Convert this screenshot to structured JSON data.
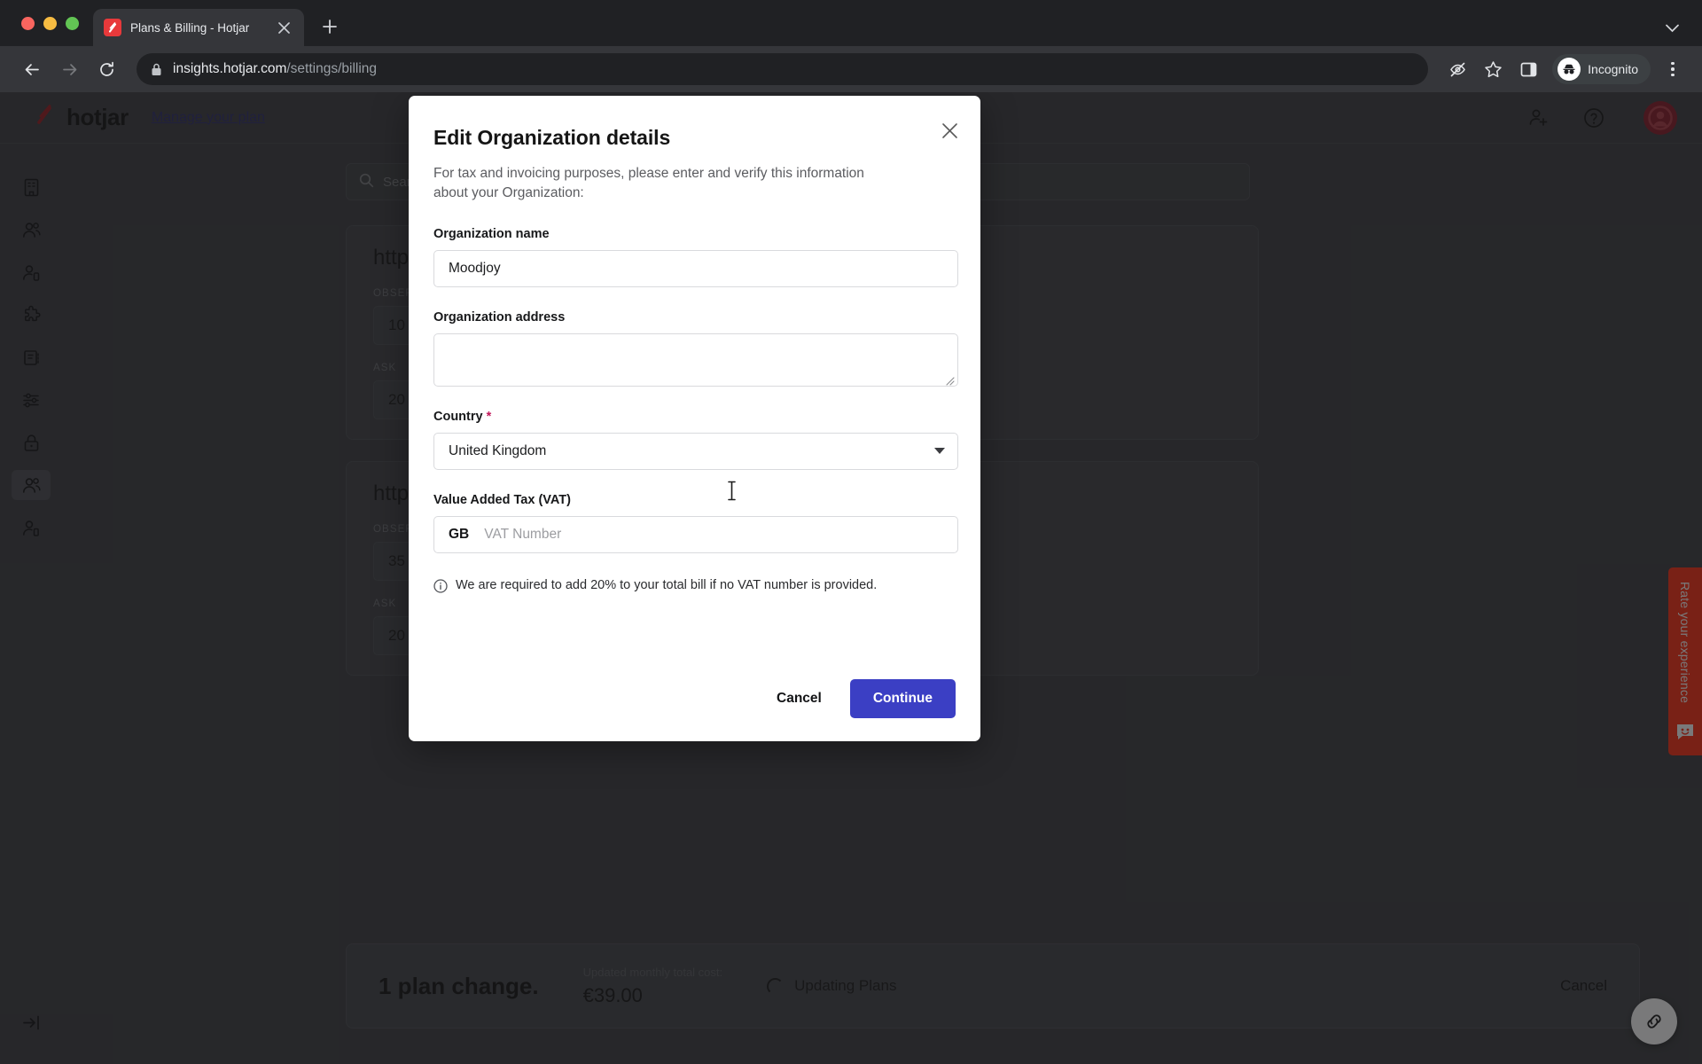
{
  "browser": {
    "tab": {
      "title": "Plans & Billing - Hotjar",
      "favicon_icon": "hotjar-favicon",
      "close_icon": "close-icon"
    },
    "new_tab_icon": "plus-icon",
    "tab_list_icon": "chevron-down-icon",
    "back_icon": "arrow-left-icon",
    "forward_icon": "arrow-right-icon",
    "reload_icon": "reload-icon",
    "url": {
      "host": "insights.hotjar.com",
      "path": "/settings/billing",
      "lock_icon": "lock-icon"
    },
    "toolbar_icons": [
      "eye-off-icon",
      "star-icon",
      "side-panel-icon"
    ],
    "incognito": {
      "label": "Incognito",
      "icon": "incognito-icon"
    },
    "menu_icon": "kebab-menu-icon"
  },
  "app": {
    "logo_text": "hotjar",
    "logo_icon": "hotjar-logo-icon",
    "manage_plan_link": "Manage your plan",
    "header_icons": [
      "add-user-icon",
      "help-circle-icon",
      "user-avatar-icon"
    ],
    "sidebar": {
      "items": [
        {
          "icon": "building-icon",
          "active": false
        },
        {
          "icon": "users-icon",
          "active": false
        },
        {
          "icon": "user-settings-icon",
          "active": false
        },
        {
          "icon": "puzzle-piece-icon",
          "active": false
        },
        {
          "icon": "notebook-icon",
          "active": false
        },
        {
          "icon": "sliders-icon",
          "active": false
        },
        {
          "icon": "lock-icon",
          "active": false
        },
        {
          "icon": "team-members-icon",
          "active": true
        },
        {
          "icon": "user-profile-icon",
          "active": false
        }
      ],
      "collapse_icon": "expand-sidebar-icon"
    },
    "search_placeholder": "Search",
    "search_icon": "search-icon",
    "plan_cards": [
      {
        "url": "http",
        "rows": [
          {
            "kicker": "OBSERVE",
            "value": "10"
          },
          {
            "kicker": "ASK",
            "value": "20"
          }
        ]
      },
      {
        "url": "http",
        "rows": [
          {
            "kicker": "OBSERVE",
            "value": "35"
          },
          {
            "kicker": "ASK",
            "value": "20"
          }
        ]
      }
    ],
    "bottom_bar": {
      "plan_change": "1 plan change.",
      "cost_label": "Updated monthly total cost:",
      "cost_value": "€39.00",
      "status": "Updating Plans",
      "status_icon": "spinner-icon",
      "cancel": "Cancel"
    },
    "rate_tab": {
      "text": "Rate your experience",
      "icon": "smiley-face-icon"
    },
    "link_fab_icon": "link-icon"
  },
  "modal": {
    "title": "Edit Organization details",
    "subtitle": "For tax and invoicing purposes, please enter and verify this information about your Organization:",
    "close_icon": "close-icon",
    "fields": {
      "org_name": {
        "label": "Organization name",
        "value": "Moodjoy"
      },
      "org_address": {
        "label": "Organization address",
        "value": "",
        "resize_icon": "resize-grip-icon"
      },
      "country": {
        "label": "Country",
        "required_mark": "*",
        "value": "United Kingdom",
        "caret_icon": "chevron-down-icon"
      },
      "vat": {
        "label": "Value Added Tax (VAT)",
        "prefix": "GB",
        "placeholder": "VAT Number",
        "value": ""
      }
    },
    "note": {
      "icon": "info-circle-icon",
      "text": "We are required to add 20% to your total bill if no VAT number is provided."
    },
    "actions": {
      "cancel": "Cancel",
      "continue": "Continue",
      "continue_color": "#3B3FC4"
    }
  },
  "cursor": {
    "icon": "text-ibeam-cursor"
  }
}
